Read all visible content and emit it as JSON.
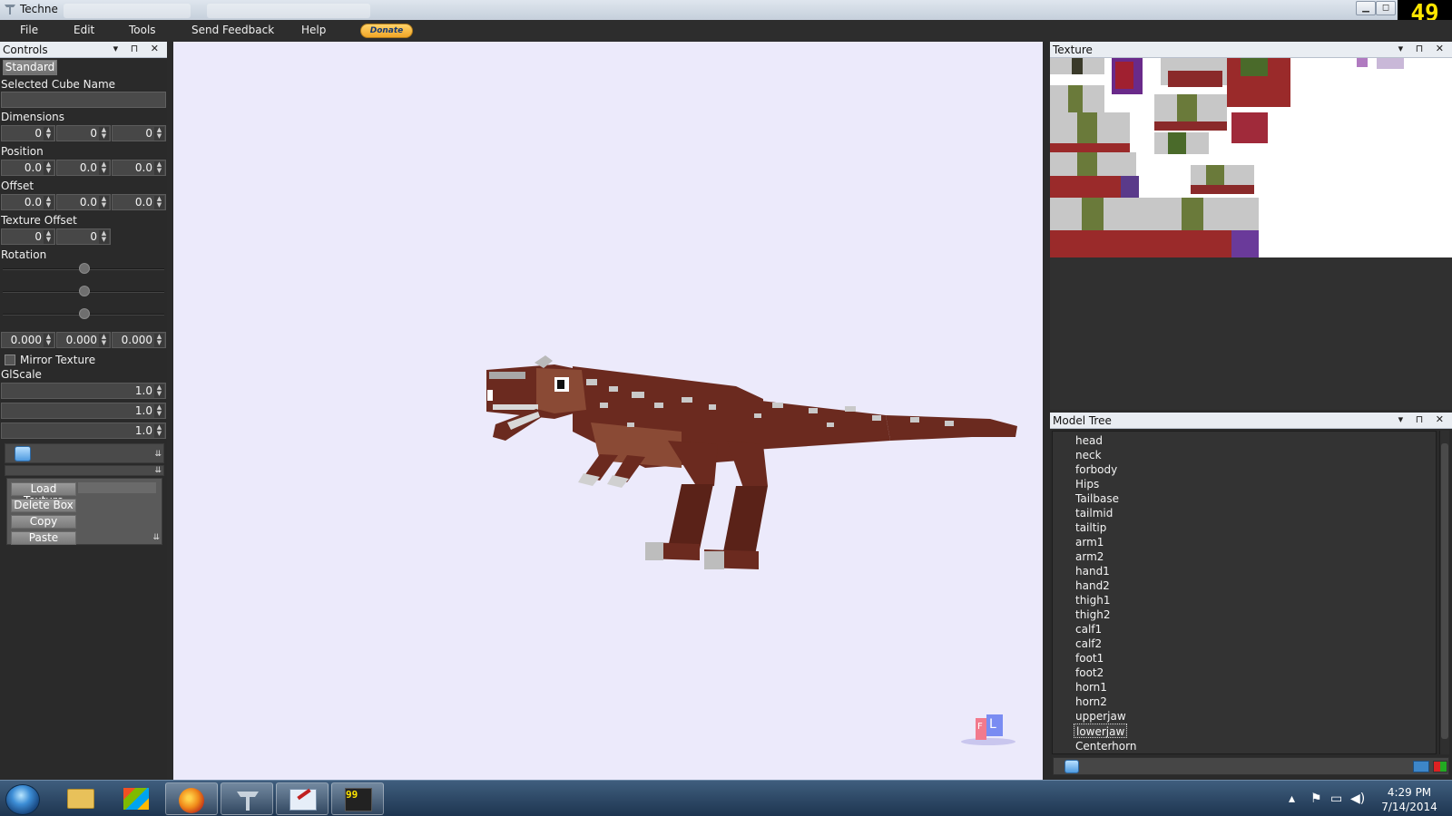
{
  "window": {
    "title": "Techne",
    "counter": "49"
  },
  "menu": {
    "items": [
      "File",
      "Edit",
      "Tools",
      "Send Feedback",
      "Help"
    ],
    "donate": "Donate"
  },
  "controls": {
    "panel_title": "Controls",
    "panel_tools": "▾ ⊓ ✕",
    "mode_button": "Standard",
    "selected_cube_label": "Selected Cube Name",
    "selected_cube_value": "",
    "dimensions_label": "Dimensions",
    "dimensions": [
      "0",
      "0",
      "0"
    ],
    "position_label": "Position",
    "position": [
      "0.0",
      "0.0",
      "0.0"
    ],
    "offset_label": "Offset",
    "offset": [
      "0.0",
      "0.0",
      "0.0"
    ],
    "texture_offset_label": "Texture Offset",
    "texture_offset": [
      "0",
      "0"
    ],
    "rotation_label": "Rotation",
    "rotation_values": [
      "0.000",
      "0.000",
      "0.000"
    ],
    "mirror_label": "Mirror Texture",
    "mirror_checked": false,
    "glscale_label": "GlScale",
    "glscale": [
      "1.0",
      "1.0",
      "1.0"
    ],
    "buttons": {
      "load_texture": "Load Texture",
      "delete_box": "Delete Box",
      "copy": "Copy",
      "paste": "Paste"
    }
  },
  "texture_panel": {
    "title": "Texture",
    "tools": "▾ ⊓ ✕"
  },
  "model_tree": {
    "title": "Model Tree",
    "tools": "▾ ⊓ ✕",
    "items": [
      "head",
      "neck",
      "forbody",
      "Hips",
      "Tailbase",
      "tailmid",
      "tailtip",
      "arm1",
      "arm2",
      "hand1",
      "hand2",
      "thigh1",
      "thigh2",
      "calf1",
      "calf2",
      "foot1",
      "foot2",
      "horn1",
      "horn2",
      "upperjaw",
      "lowerjaw",
      "Centerhorn"
    ],
    "selected": "lowerjaw"
  },
  "viewport": {
    "background": "#eceafb",
    "model_colors": {
      "main": "#6b2a1f",
      "light": "#8a4a35",
      "spots": "#c9c9c9"
    },
    "cube_letters": {
      "front": "F",
      "left": "L"
    }
  },
  "taskbar": {
    "time": "4:29 PM",
    "date": "7/14/2014"
  }
}
